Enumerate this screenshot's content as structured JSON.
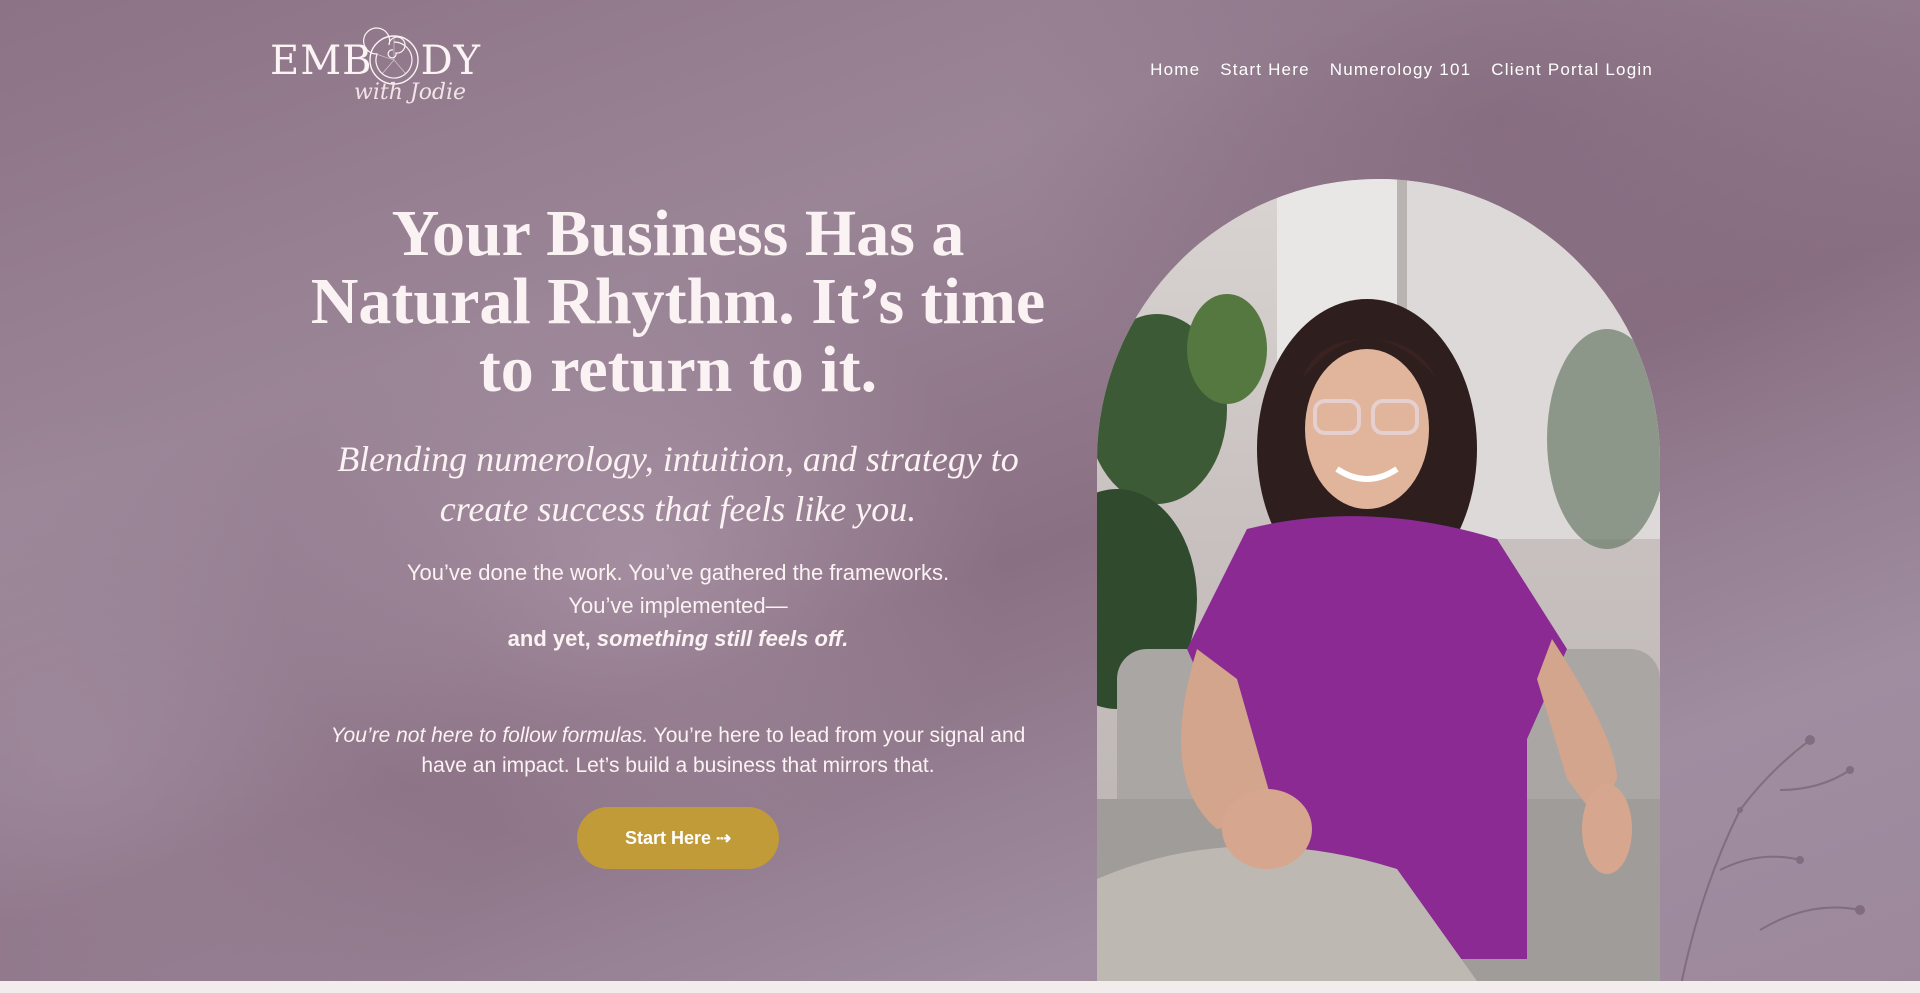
{
  "brand": {
    "logo_word_left": "EMB",
    "logo_word_right": "DY",
    "logo_sub": "with Jodie"
  },
  "nav": {
    "items": [
      {
        "label": "Home"
      },
      {
        "label": "Start Here"
      },
      {
        "label": "Numerology 101"
      },
      {
        "label": "Client Portal Login"
      }
    ]
  },
  "hero": {
    "headline": "Your Business Has a Natural Rhythm. It’s time to return to it.",
    "subhead": "Blending numerology, intuition, and strategy to create success that feels like you.",
    "line1": "You’ve done the work. You’ve gathered the frameworks.",
    "line2": "You’ve implemented—",
    "line3_bold": "and yet, ",
    "line3_bold_italic": "something still feels off.",
    "para2_italic": "You’re not here to follow formulas.",
    "para2_rest": " You’re here to lead from your signal and have an impact. Let’s build a business that mirrors that.",
    "cta_label": "Start Here ⇢"
  },
  "colors": {
    "background": "#957d90",
    "cta": "#c19b38",
    "text": "#fbf2f3",
    "blouse": "#8a2a92"
  },
  "icons": {
    "logo_shell": "nautilus-shell-icon"
  }
}
